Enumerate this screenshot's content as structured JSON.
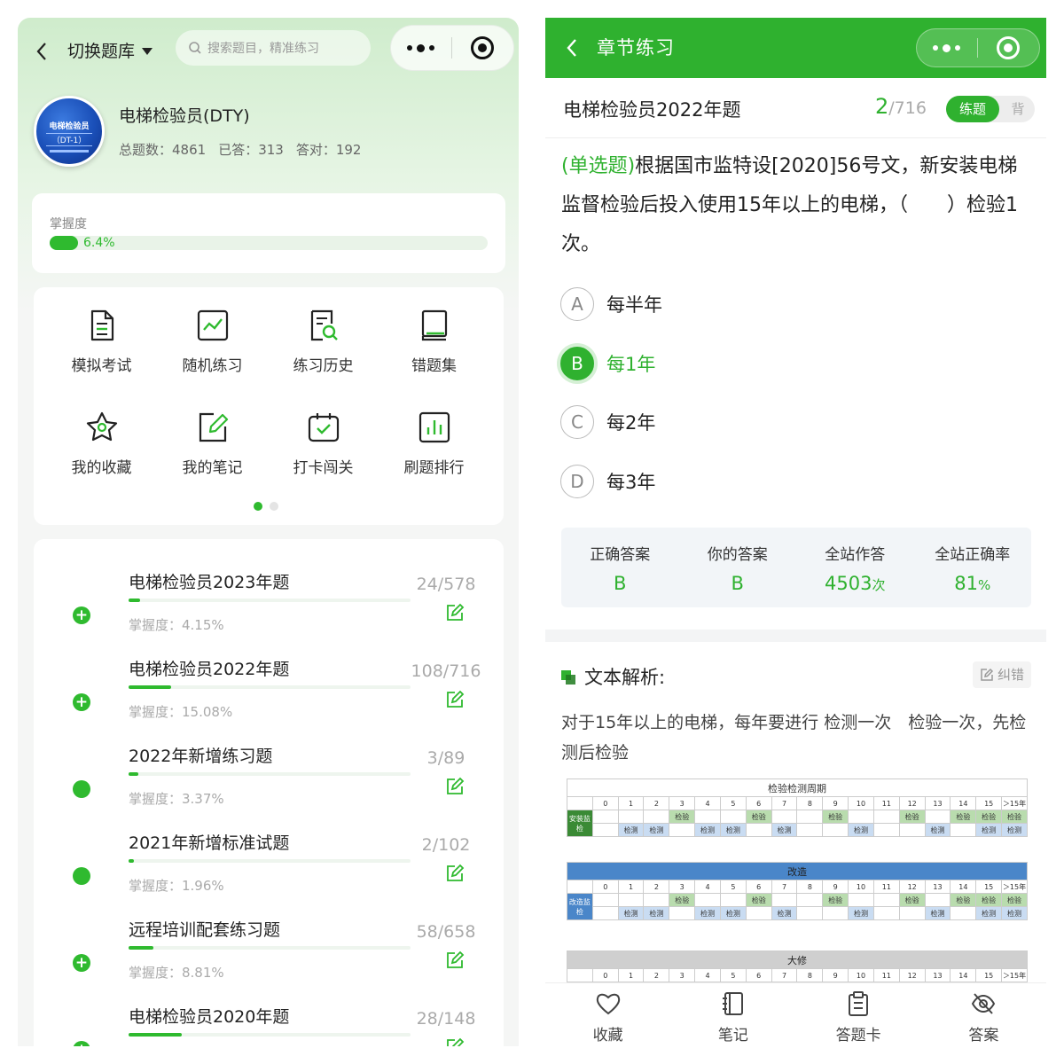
{
  "left": {
    "nav": {
      "switch_label": "切换题库",
      "search_placeholder": "搜索题目，精准练习"
    },
    "library": {
      "logo": {
        "line1": "电梯检验员",
        "line2": "（DT-1）"
      },
      "name": "电梯检验员(DTY)",
      "stats": {
        "total": "总题数：4861",
        "answered": "已答：313",
        "correct": "答对：192"
      }
    },
    "mastery": {
      "label": "掌握度",
      "value": 6.4,
      "text": "6.4%"
    },
    "grid": [
      {
        "label": "模拟考试",
        "icon": "exam-doc-icon"
      },
      {
        "label": "随机练习",
        "icon": "trend-chart-icon"
      },
      {
        "label": "练习历史",
        "icon": "history-search-icon"
      },
      {
        "label": "错题集",
        "icon": "book-icon"
      },
      {
        "label": "我的收藏",
        "icon": "star-icon"
      },
      {
        "label": "我的笔记",
        "icon": "edit-note-icon"
      },
      {
        "label": "打卡闯关",
        "icon": "calendar-check-icon"
      },
      {
        "label": "刷题排行",
        "icon": "bar-chart-icon"
      }
    ],
    "colors": {
      "accent": "#2fba2f"
    },
    "banks": [
      {
        "title": "电梯检验员2023年题",
        "count": "24/578",
        "mastery_text": "掌握度：4.15%",
        "mastery": 4.15,
        "status": "plus"
      },
      {
        "title": "电梯检验员2022年题",
        "count": "108/716",
        "mastery_text": "掌握度：15.08%",
        "mastery": 15.08,
        "status": "plus"
      },
      {
        "title": "2022年新增练习题",
        "count": "3/89",
        "mastery_text": "掌握度：3.37%",
        "mastery": 3.37,
        "status": "dot"
      },
      {
        "title": "2021年新增标准试题",
        "count": "2/102",
        "mastery_text": "掌握度：1.96%",
        "mastery": 1.96,
        "status": "dot"
      },
      {
        "title": "远程培训配套练习题",
        "count": "58/658",
        "mastery_text": "掌握度：8.81%",
        "mastery": 8.81,
        "status": "plus"
      },
      {
        "title": "电梯检验员2020年题",
        "count": "28/148",
        "mastery_text": "",
        "mastery": 18.9,
        "status": "plus"
      }
    ]
  },
  "right": {
    "nav": {
      "title": "章节练习"
    },
    "bank": "电梯检验员2022年题",
    "progress": {
      "current": "2",
      "total": "/716"
    },
    "mode": {
      "practice": "练题",
      "memorize": "背"
    },
    "question": {
      "type": "(单选题)",
      "text": "根据国市监特设[2020]56号文，新安装电梯监督检验后投入使用15年以上的电梯，（　　）检验1次。"
    },
    "options": [
      {
        "key": "A",
        "text": "每半年",
        "selected": false
      },
      {
        "key": "B",
        "text": "每1年",
        "selected": true
      },
      {
        "key": "C",
        "text": "每2年",
        "selected": false
      },
      {
        "key": "D",
        "text": "每3年",
        "selected": false
      }
    ],
    "stats": [
      {
        "label": "正确答案",
        "value": "B",
        "unit": ""
      },
      {
        "label": "你的答案",
        "value": "B",
        "unit": ""
      },
      {
        "label": "全站作答",
        "value": "4503",
        "unit": "次"
      },
      {
        "label": "全站正确率",
        "value": "81",
        "unit": "%"
      }
    ],
    "analysis": {
      "title": "文本解析:",
      "fix_label": "纠错",
      "text": "对于15年以上的电梯，每年要进行 检测一次　检验一次，先检测后检验"
    },
    "tables": {
      "t1_caption": "检验检测周期",
      "t2_caption": "改造",
      "t3_caption": "大修",
      "years": [
        "0",
        "1",
        "2",
        "3",
        "4",
        "5",
        "6",
        "7",
        "8",
        "9",
        "10",
        "11",
        "12",
        "13",
        "14",
        "15",
        "＞15年"
      ],
      "t1_side": "安装监检",
      "t2_side": "改造监检",
      "ins": "检验",
      "det": "检测"
    },
    "bottom": [
      {
        "label": "收藏",
        "icon": "heart-icon"
      },
      {
        "label": "笔记",
        "icon": "notebook-icon"
      },
      {
        "label": "答题卡",
        "icon": "clipboard-icon"
      },
      {
        "label": "答案",
        "icon": "eye-off-icon"
      }
    ],
    "colors": {
      "accent": "#2fb12f"
    }
  }
}
